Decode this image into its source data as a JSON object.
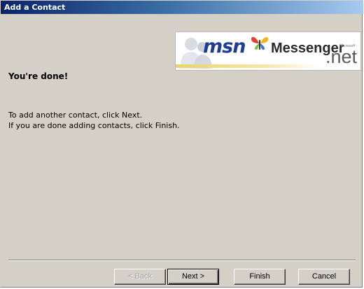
{
  "window": {
    "title": "Add a Contact"
  },
  "logo": {
    "msn": "msn",
    "messenger": "Messenger",
    "microsoft": "Microsoft",
    "net": ".net"
  },
  "content": {
    "heading": "You're done!",
    "line1": "To add another contact, click Next.",
    "line2": "If you are done adding contacts, click Finish."
  },
  "buttons": {
    "back": "< Back",
    "next": "Next >",
    "finish": "Finish",
    "cancel": "Cancel"
  },
  "state": {
    "back_enabled": false,
    "default_button": "next"
  },
  "colors": {
    "titlebar_start": "#0a246a",
    "titlebar_end": "#a6caf0",
    "dialog_face": "#d4d0c8",
    "msn_blue": "#1f3c94"
  }
}
